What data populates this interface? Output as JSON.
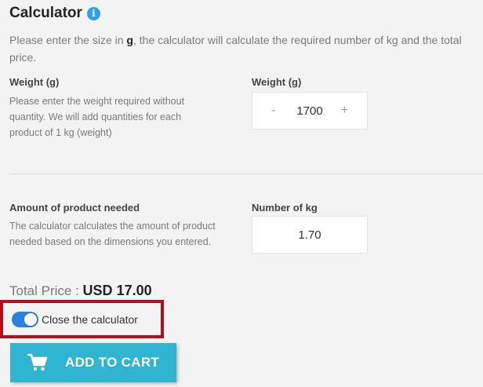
{
  "header": {
    "title": "Calculator",
    "info_glyph": "i"
  },
  "intro": {
    "before": "Please enter the size in ",
    "unit": "g",
    "after": ", the calculator will calculate the required number of kg and the total price."
  },
  "weight_section": {
    "label": "Weight (g)",
    "description_lines": [
      "Please enter the weight required without",
      "quantity. We will add quantities for each",
      "product of 1 kg (weight)"
    ],
    "field_label": "Weight (g)",
    "value": "1700",
    "minus": "-",
    "plus": "+"
  },
  "amount_section": {
    "label": "Amount of product needed",
    "description_lines": [
      "The calculator calculates the amount of product",
      "needed based on the dimensions you entered."
    ],
    "field_label": "Number of kg",
    "value": "1.70"
  },
  "total": {
    "label": "Total Price : ",
    "value": "USD 17.00"
  },
  "toggle": {
    "label": "Close the calculator",
    "on": true,
    "color": "#2a7fe0"
  },
  "cart_button": {
    "label": "ADD TO CART",
    "icon": "cart-icon",
    "color": "#2fb5d2"
  }
}
